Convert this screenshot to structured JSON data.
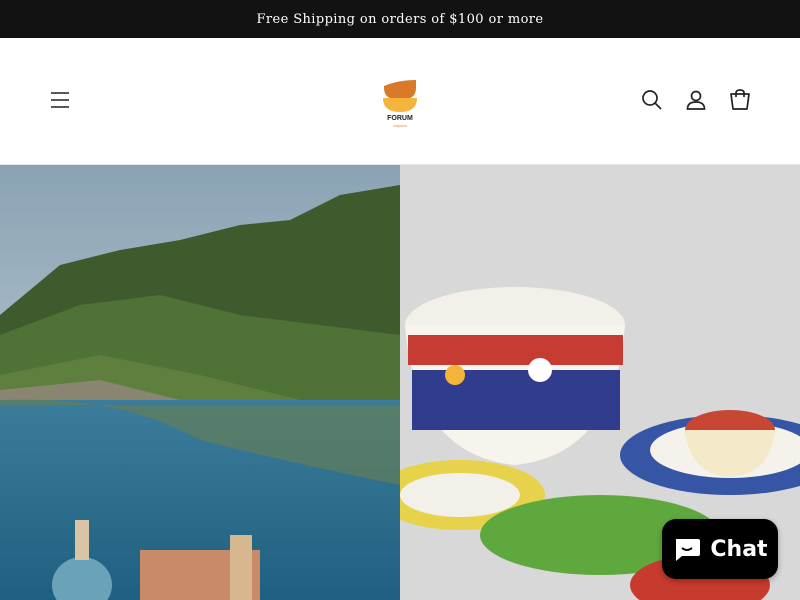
{
  "announcement": {
    "text": "Free Shipping on orders of $100 or more"
  },
  "header": {
    "logo": {
      "name": "FORUM",
      "sub": "Imports"
    },
    "icons": [
      "menu-icon",
      "search-icon",
      "account-icon",
      "cart-icon"
    ]
  },
  "hero": {
    "left_image": "amalfi-coast-photo",
    "right_image": "painted-ceramic-bowls-photo"
  },
  "chat": {
    "label": "Chat",
    "icon": "chat-bubble-icon"
  },
  "colors": {
    "announce_bg": "#121212",
    "chat_bg": "#000000",
    "logo_orange": "#e58a2c",
    "logo_yellow": "#f3b53b"
  }
}
